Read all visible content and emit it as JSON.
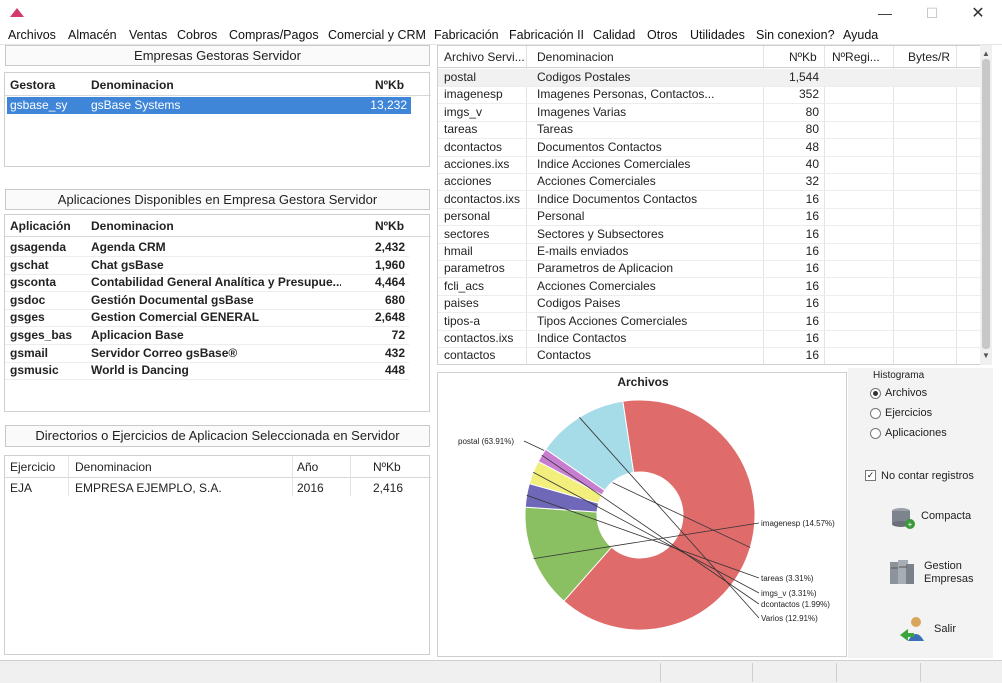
{
  "window": {
    "minimize": "—",
    "maximize": "☐",
    "close": "✕"
  },
  "menu": [
    "Archivos",
    "Almacén",
    "Ventas",
    "Cobros",
    "Compras/Pagos",
    "Comercial y CRM",
    "Fabricación",
    "Fabricación II",
    "Calidad",
    "Otros",
    "Utilidades",
    "Sin conexion?",
    "Ayuda"
  ],
  "gestoras": {
    "title": "Empresas Gestoras Servidor",
    "headers": [
      "Gestora",
      "Denominacion",
      "NºKb"
    ],
    "rows": [
      [
        "gsbase_sy",
        "gsBase Systems",
        "13,232"
      ]
    ]
  },
  "aplicaciones": {
    "title": "Aplicaciones Disponibles en Empresa Gestora Servidor",
    "headers": [
      "Aplicación",
      "Denominacion",
      "NºKb"
    ],
    "rows": [
      [
        "gsagenda",
        "Agenda CRM",
        "2,432"
      ],
      [
        "gschat",
        "Chat gsBase",
        "1,960"
      ],
      [
        "gsconta",
        "Contabilidad General Analítica y Presupue...",
        "4,464"
      ],
      [
        "gsdoc",
        "Gestión Documental gsBase",
        "680"
      ],
      [
        "gsges",
        "Gestion Comercial GENERAL",
        "2,648"
      ],
      [
        "gsges_bas",
        "Aplicacion Base",
        "72"
      ],
      [
        "gsmail",
        "Servidor Correo gsBase®",
        "432"
      ],
      [
        "gsmusic",
        "World is Dancing",
        "448"
      ]
    ]
  },
  "ejercicios": {
    "title": "Directorios o Ejercicios de Aplicacion Seleccionada en Servidor",
    "headers": [
      "Ejercicio",
      "Denominacion",
      "Año",
      "NºKb"
    ],
    "rows": [
      [
        "EJA",
        "EMPRESA EJEMPLO, S.A.",
        "2016",
        "2,416"
      ]
    ]
  },
  "archivos": {
    "headers": [
      "Archivo Servi...",
      "Denominacion",
      "NºKb",
      "NºRegi...",
      "Bytes/R"
    ],
    "rows": [
      [
        "postal",
        "Codigos Postales",
        "1,544"
      ],
      [
        "imagenesp",
        "Imagenes Personas, Contactos...",
        "352"
      ],
      [
        "imgs_v",
        "Imagenes Varias",
        "80"
      ],
      [
        "tareas",
        "Tareas",
        "80"
      ],
      [
        "dcontactos",
        "Documentos Contactos",
        "48"
      ],
      [
        "acciones.ixs",
        "Indice Acciones Comerciales",
        "40"
      ],
      [
        "acciones",
        "Acciones Comerciales",
        "32"
      ],
      [
        "dcontactos.ixs",
        "Indice Documentos Contactos",
        "16"
      ],
      [
        "personal",
        "Personal",
        "16"
      ],
      [
        "sectores",
        "Sectores y Subsectores",
        "16"
      ],
      [
        "hmail",
        "E-mails enviados",
        "16"
      ],
      [
        "parametros",
        "Parametros de Aplicacion",
        "16"
      ],
      [
        "fcli_acs",
        "Acciones Comerciales",
        "16"
      ],
      [
        "paises",
        "Codigos Paises",
        "16"
      ],
      [
        "tipos-a",
        "Tipos Acciones Comerciales",
        "16"
      ],
      [
        "contactos.ixs",
        "Indice Contactos",
        "16"
      ],
      [
        "contactos",
        "Contactos",
        "16"
      ]
    ]
  },
  "histograma": {
    "title": "Histograma",
    "options": [
      "Archivos",
      "Ejercicios",
      "Aplicaciones"
    ],
    "selected": 0,
    "checkbox_label": "No contar registros",
    "checkbox_checked": true
  },
  "buttons": {
    "compacta": "Compacta",
    "gestion_l1": "Gestion",
    "gestion_l2": "Empresas",
    "salir": "Salir"
  },
  "chart_data": {
    "type": "pie",
    "title": "Archivos",
    "slices": [
      {
        "label": "postal (63.91%)",
        "value": 63.91,
        "color": "#e06b6b"
      },
      {
        "label": "imagenesp (14.57%)",
        "value": 14.57,
        "color": "#8bc062"
      },
      {
        "label": "tareas (3.31%)",
        "value": 3.31,
        "color": "#6f67b8"
      },
      {
        "label": "imgs_v (3.31%)",
        "value": 3.31,
        "color": "#f2ef7c"
      },
      {
        "label": "dcontactos (1.99%)",
        "value": 1.99,
        "color": "#c77ed0"
      },
      {
        "label": "Varios (12.91%)",
        "value": 12.91,
        "color": "#a6dbe8"
      }
    ]
  }
}
